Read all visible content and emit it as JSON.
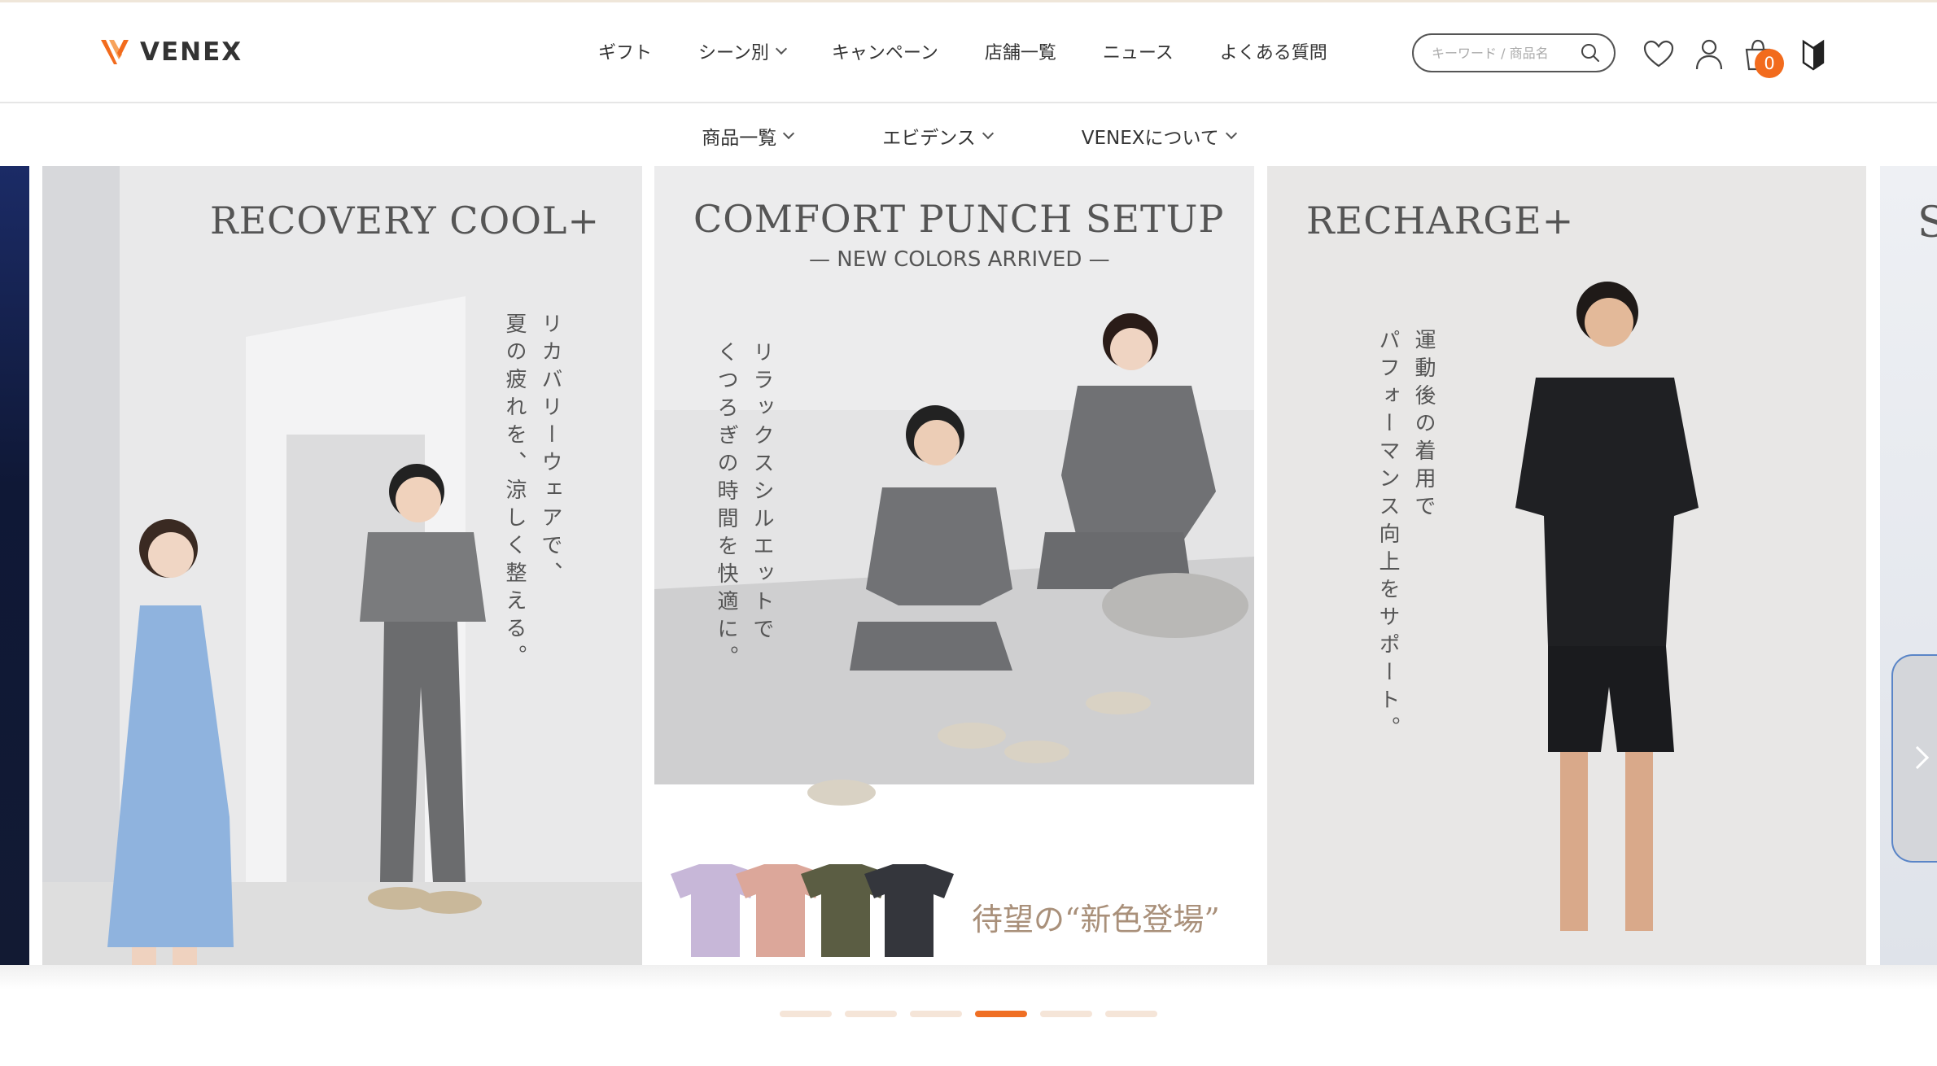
{
  "header": {
    "logo_text": "VENEX",
    "nav": [
      "ギフト",
      "シーン別",
      "キャンペーン",
      "店舗一覧",
      "ニュース",
      "よくある質問"
    ],
    "search_placeholder": "キーワード / 商品名",
    "cart_count": "0"
  },
  "subnav": [
    "商品一覧",
    "エビデンス",
    "VENEXについて"
  ],
  "slides": [
    {
      "title": "RECOVERY COOL+",
      "vertical_lines": [
        "リカバリーウェアで、",
        "夏の疲れを、涼しく整える。"
      ]
    },
    {
      "title": "COMFORT PUNCH SETUP",
      "subtitle": "— NEW COLORS ARRIVED —",
      "vertical_lines": [
        "リラックスシルエットで",
        "くつろぎの時間を快適に。"
      ],
      "tagline": "待望の“新色登場”"
    },
    {
      "title": "RECHARGE+",
      "vertical_lines": [
        "運動後の着用で",
        "パフォーマンス向上をサポート。"
      ]
    }
  ],
  "peek_letter": "S",
  "carousel": {
    "dot_count": 6,
    "active_index": 3
  },
  "colors": {
    "accent": "#ef6f24",
    "badge": "#f26b1d",
    "dot_inactive": "#f5e5d8"
  }
}
